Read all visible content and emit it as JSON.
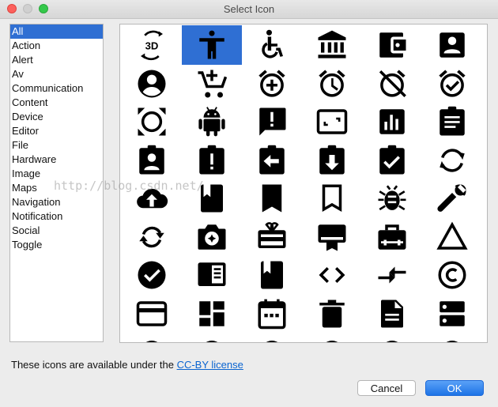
{
  "window": {
    "title": "Select Icon"
  },
  "categories": [
    "All",
    "Action",
    "Alert",
    "Av",
    "Communication",
    "Content",
    "Device",
    "Editor",
    "File",
    "Hardware",
    "Image",
    "Maps",
    "Navigation",
    "Notification",
    "Social",
    "Toggle"
  ],
  "selected_category": "All",
  "icons": [
    "3d-rotation-icon",
    "accessibility-icon",
    "accessible-icon",
    "account-balance-icon",
    "account-balance-wallet-icon",
    "account-box-icon",
    "account-circle-icon",
    "add-shopping-cart-icon",
    "alarm-add-icon",
    "alarm-icon",
    "alarm-off-icon",
    "alarm-on-icon",
    "all-out-icon",
    "android-icon",
    "announcement-icon",
    "aspect-ratio-icon",
    "assessment-icon",
    "assignment-icon",
    "assignment-ind-icon",
    "assignment-late-icon",
    "assignment-return-icon",
    "assignment-returned-icon",
    "assignment-turned-in-icon",
    "autorenew-icon",
    "backup-icon",
    "book-icon",
    "bookmark-icon",
    "bookmark-border-icon",
    "bug-report-icon",
    "build-icon",
    "cached-icon",
    "camera-enhance-icon",
    "card-giftcard-icon",
    "card-membership-icon",
    "card-travel-icon",
    "change-history-icon",
    "check-circle-icon",
    "chrome-reader-mode-icon",
    "class-icon",
    "code-icon",
    "compare-arrows-icon",
    "copyright-icon",
    "credit-card-icon",
    "dashboard-icon",
    "date-range-icon",
    "delete-icon",
    "description-icon",
    "dns-icon"
  ],
  "selected_icon": "accessibility-icon",
  "watermark": "http://blog.csdn.net/",
  "footer": {
    "license_prefix": "These icons are available under the ",
    "license_link": "CC-BY license"
  },
  "buttons": {
    "cancel": "Cancel",
    "ok": "OK"
  },
  "colors": {
    "selection": "#2f6fd3",
    "ok_button": "#1d73e6",
    "link": "#0a64d0",
    "close": "#fc605c",
    "maximize": "#34c84a"
  }
}
